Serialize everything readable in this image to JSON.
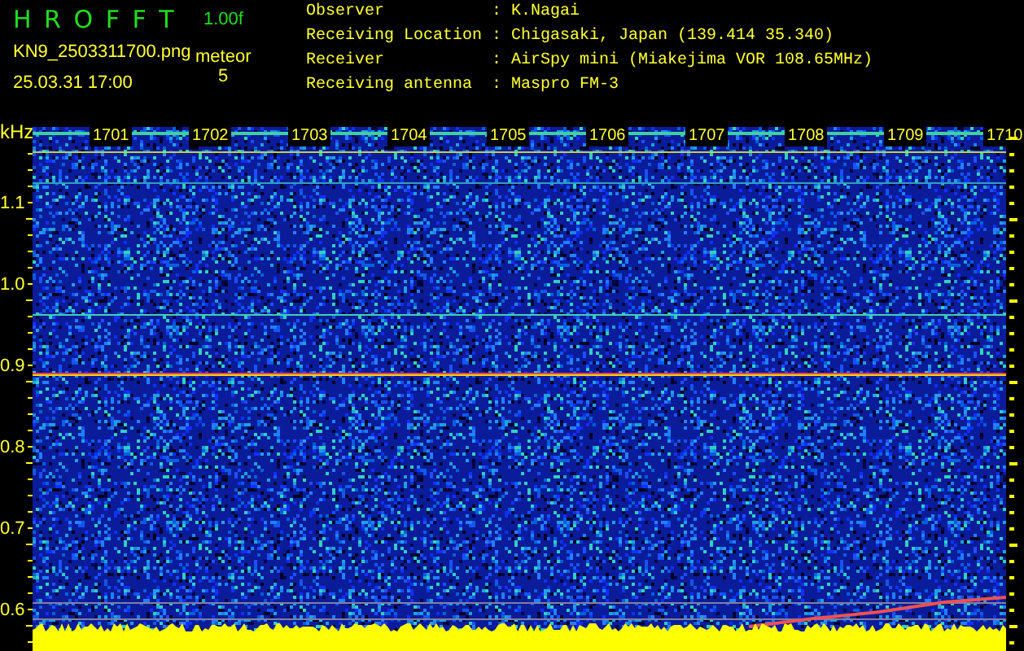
{
  "header": {
    "title": "H R O F F T",
    "version": "1.00f",
    "filename": "KN9_2503311700.png",
    "timestamp": "25.03.31 17:00",
    "count_label": "meteor",
    "count": "5"
  },
  "info": [
    {
      "label": "Observer",
      "separator": ":",
      "value": "K.Nagai"
    },
    {
      "label": "Receiving Location",
      "separator": ":",
      "value": "Chigasaki, Japan (139.414 35.340)"
    },
    {
      "label": "Receiver",
      "separator": ":",
      "value": "AirSpy mini (Miakejima VOR 108.65MHz)"
    },
    {
      "label": "Receiving antenna",
      "separator": ":",
      "value": "Maspro FM-3"
    }
  ],
  "plot": {
    "unit": "kHz",
    "freq_labels": [
      "1.1",
      "1.0",
      "0.9",
      "0.8",
      "0.7",
      "0.6"
    ],
    "time_labels": [
      "1701",
      "1702",
      "1703",
      "1704",
      "1705",
      "1706",
      "1707",
      "1708",
      "1709",
      "1710"
    ]
  }
}
